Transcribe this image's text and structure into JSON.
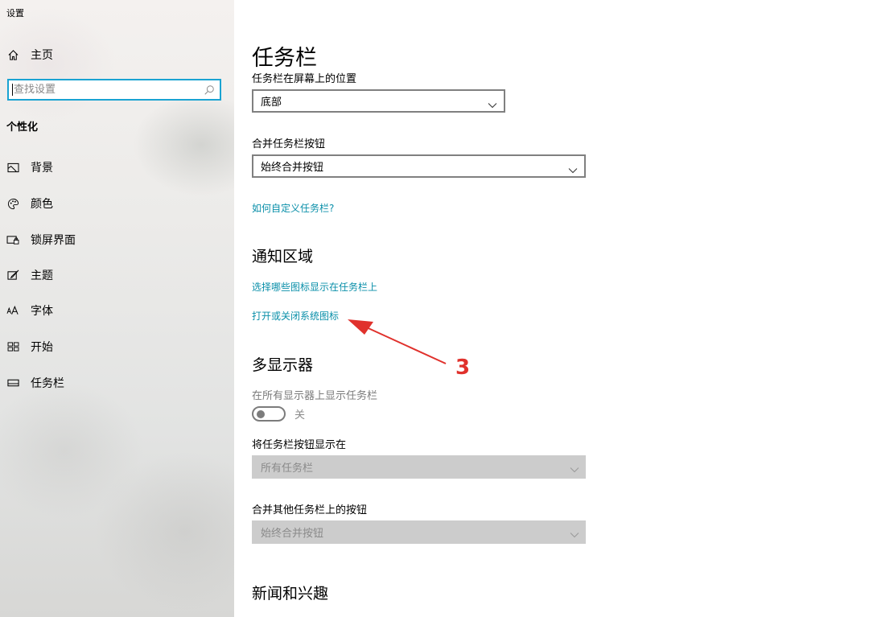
{
  "window": {
    "title": "设置"
  },
  "sidebar": {
    "home": {
      "label": "主页",
      "icon": "home-icon"
    },
    "search": {
      "placeholder": "查找设置",
      "icon": "search-icon"
    },
    "section": "个性化",
    "items": [
      {
        "label": "背景",
        "icon": "picture-icon"
      },
      {
        "label": "颜色",
        "icon": "palette-icon"
      },
      {
        "label": "锁屏界面",
        "icon": "lockscreen-icon"
      },
      {
        "label": "主题",
        "icon": "theme-brush-icon"
      },
      {
        "label": "字体",
        "icon": "font-icon"
      },
      {
        "label": "开始",
        "icon": "start-grid-icon"
      },
      {
        "label": "任务栏",
        "icon": "taskbar-icon"
      }
    ]
  },
  "main": {
    "title": "任务栏",
    "position": {
      "label": "任务栏在屏幕上的位置",
      "value": "底部"
    },
    "combine": {
      "label": "合并任务栏按钮",
      "value": "始终合并按钮"
    },
    "customize_link": "如何自定义任务栏?",
    "notification_area": {
      "title": "通知区域",
      "link_select_icons": "选择哪些图标显示在任务栏上",
      "link_system_icons": "打开或关闭系统图标"
    },
    "multi_display": {
      "title": "多显示器",
      "show_on_all": {
        "label": "在所有显示器上显示任务栏",
        "state": "关",
        "on": false
      },
      "buttons_on": {
        "label": "将任务栏按钮显示在",
        "value": "所有任务栏"
      },
      "combine_other": {
        "label": "合并其他任务栏上的按钮",
        "value": "始终合并按钮"
      }
    },
    "news_title": "新闻和兴趣"
  },
  "annotation": {
    "number": "3",
    "color": "#e0312c"
  },
  "colors": {
    "link": "#0a8fa9",
    "search_border": "#1aa3d2"
  }
}
